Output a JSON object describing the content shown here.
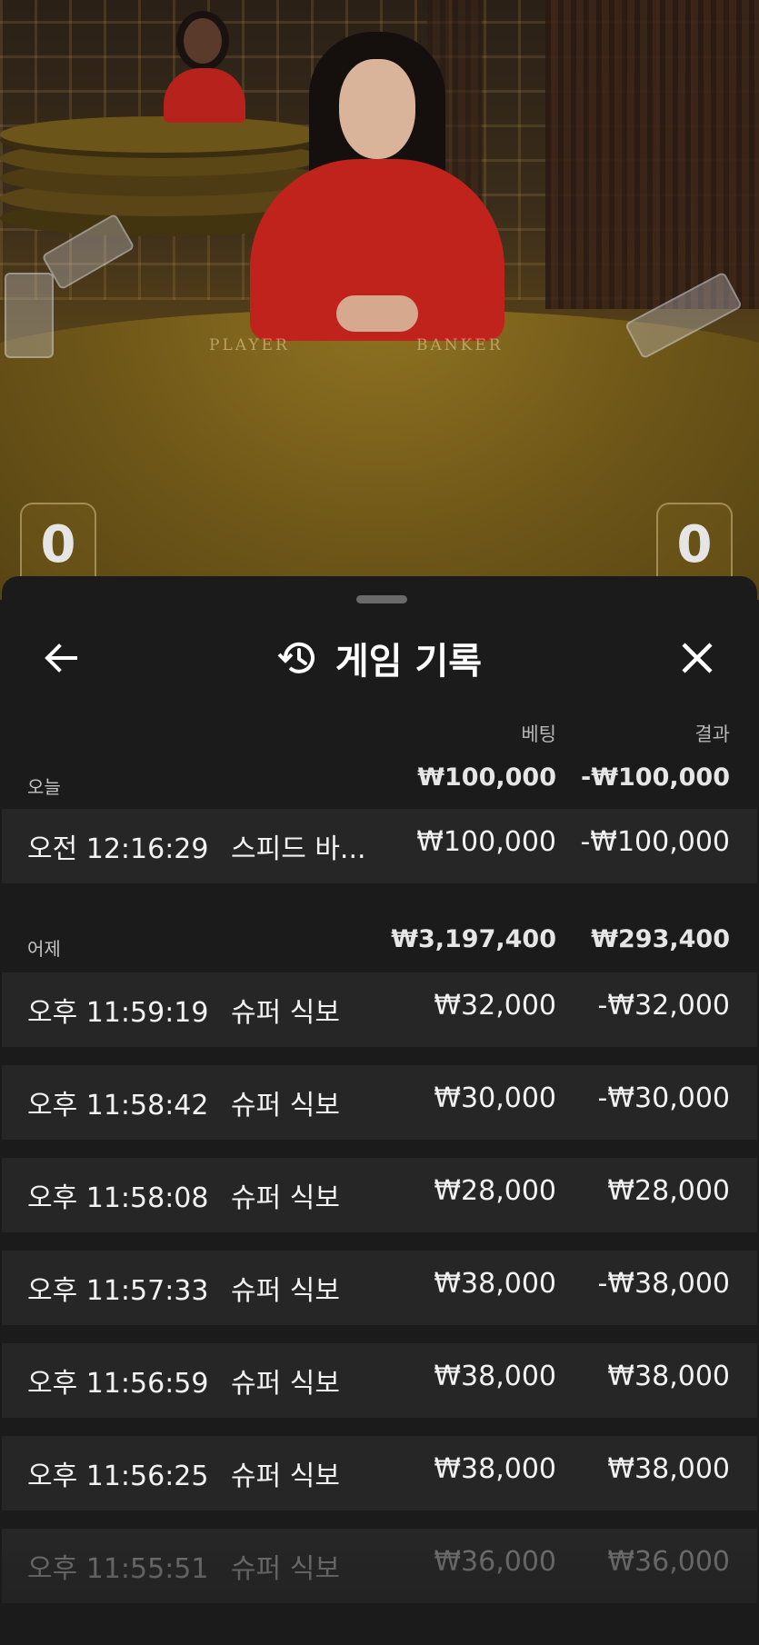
{
  "video": {
    "table_labels": {
      "player": "PLAYER",
      "banker": "BANKER"
    },
    "player_score": "0",
    "banker_score": "0"
  },
  "sheet": {
    "title": "게임 기록",
    "icons": {
      "back": "arrow-left-icon",
      "title": "history-icon",
      "close": "close-icon"
    },
    "columns": {
      "bet": "베팅",
      "result": "결과"
    },
    "groups": [
      {
        "label": "오늘",
        "bet_total": "₩100,000",
        "result_total": "-₩100,000",
        "rows": [
          {
            "time": "오전 12:16:29",
            "game": "스피드 바...",
            "bet": "₩100,000",
            "result": "-₩100,000"
          }
        ]
      },
      {
        "label": "어제",
        "bet_total": "₩3,197,400",
        "result_total": "₩293,400",
        "rows": [
          {
            "time": "오후 11:59:19",
            "game": "슈퍼 식보",
            "bet": "₩32,000",
            "result": "-₩32,000"
          },
          {
            "time": "오후 11:58:42",
            "game": "슈퍼 식보",
            "bet": "₩30,000",
            "result": "-₩30,000"
          },
          {
            "time": "오후 11:58:08",
            "game": "슈퍼 식보",
            "bet": "₩28,000",
            "result": "₩28,000"
          },
          {
            "time": "오후 11:57:33",
            "game": "슈퍼 식보",
            "bet": "₩38,000",
            "result": "-₩38,000"
          },
          {
            "time": "오후 11:56:59",
            "game": "슈퍼 식보",
            "bet": "₩38,000",
            "result": "₩38,000"
          },
          {
            "time": "오후 11:56:25",
            "game": "슈퍼 식보",
            "bet": "₩38,000",
            "result": "₩38,000"
          },
          {
            "time": "오후 11:55:51",
            "game": "슈퍼 식보",
            "bet": "₩36,000",
            "result": "₩36,000"
          }
        ]
      }
    ]
  }
}
